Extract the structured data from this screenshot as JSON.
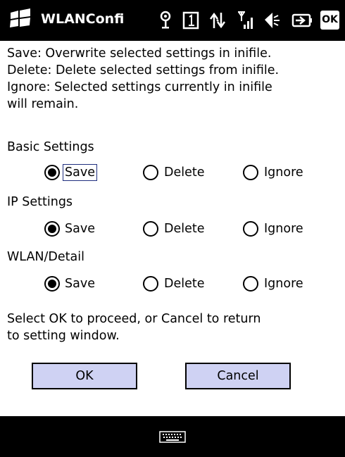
{
  "titlebar": {
    "title": "WLANConfi",
    "ok_label": "OK",
    "icons": [
      "start-flag-icon",
      "connectivity-icon",
      "one-icon",
      "sync-arrows-icon",
      "signal-icon",
      "speaker-mute-icon",
      "battery-icon"
    ]
  },
  "info": {
    "line1": "Save: Overwrite selected settings in inifile.",
    "line2": "Delete: Delete selected settings from inifile.",
    "line3": "Ignore: Selected settings currently in inifile",
    "line4": "will remain."
  },
  "groups": [
    {
      "label": "Basic Settings",
      "save": "Save",
      "delete": "Delete",
      "ignore": "Ignore",
      "selected": "save"
    },
    {
      "label": "IP Settings",
      "save": "Save",
      "delete": "Delete",
      "ignore": "Ignore",
      "selected": "save"
    },
    {
      "label": "WLAN/Detail",
      "save": "Save",
      "delete": "Delete",
      "ignore": "Ignore",
      "selected": "save"
    }
  ],
  "prompt": {
    "line1": "Select OK to proceed, or Cancel to return",
    "line2": "to setting window."
  },
  "buttons": {
    "ok": "OK",
    "cancel": "Cancel"
  },
  "colors": {
    "button_fill": "#cfd2f3",
    "bar": "#000000"
  }
}
